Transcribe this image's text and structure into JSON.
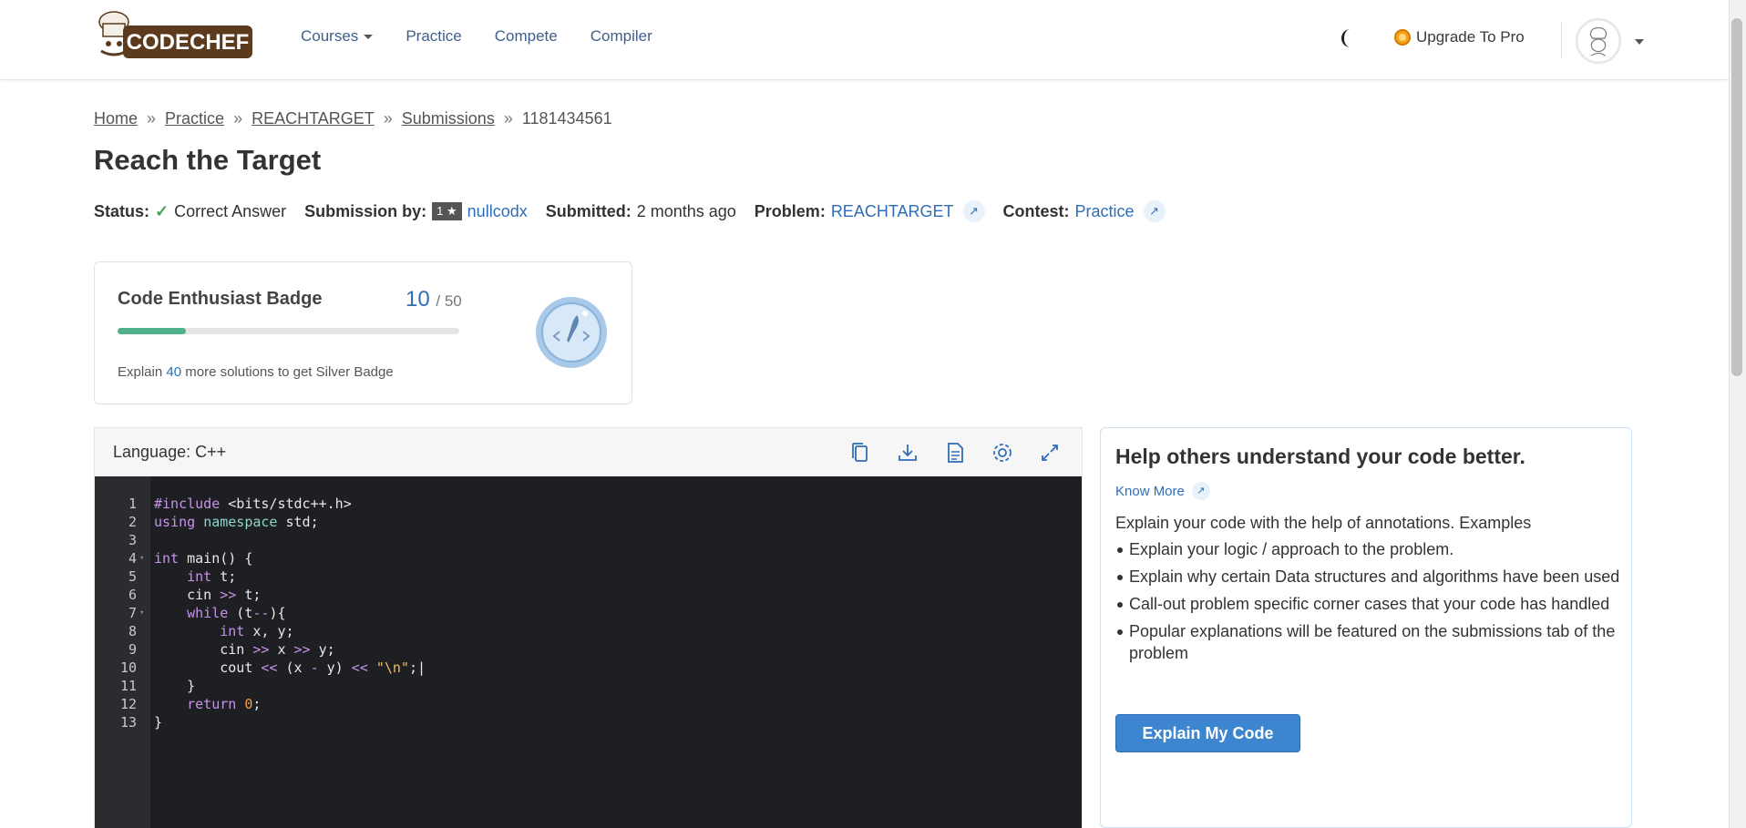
{
  "header": {
    "logo_text": "CODECHEF",
    "nav": [
      {
        "label": "Courses",
        "has_dropdown": true
      },
      {
        "label": "Practice"
      },
      {
        "label": "Compete"
      },
      {
        "label": "Compiler"
      }
    ],
    "upgrade_label": "Upgrade To Pro",
    "icons": {
      "theme": "moon-icon",
      "upgrade": "coin-icon",
      "user": "chef-avatar"
    }
  },
  "breadcrumb": {
    "items": [
      "Home",
      "Practice",
      "REACHTARGET",
      "Submissions"
    ],
    "current": "1181434561",
    "separator": "»"
  },
  "page_title": "Reach the Target",
  "meta": {
    "status_label": "Status:",
    "status_value": "Correct Answer",
    "submission_by_label": "Submission by:",
    "rank": "1 ★",
    "user": "nullcodx",
    "submitted_label": "Submitted:",
    "submitted_value": "2 months ago",
    "problem_label": "Problem:",
    "problem_value": "REACHTARGET",
    "contest_label": "Contest:",
    "contest_value": "Practice"
  },
  "badge": {
    "title": "Code Enthusiast Badge",
    "count": "10",
    "total": "/ 50",
    "progress_fraction": 0.2,
    "text_prefix": "Explain",
    "text_highlight": "40",
    "text_suffix": "more solutions to get Silver Badge"
  },
  "code": {
    "language_label": "Language: C++",
    "tools": [
      "copy-icon",
      "download-icon",
      "file-icon",
      "settings-icon",
      "fullscreen-icon"
    ],
    "line_numbers": [
      "1",
      "2",
      "3",
      "4",
      "5",
      "6",
      "7",
      "8",
      "9",
      "10",
      "11",
      "12",
      "13"
    ],
    "lines": [
      "#include <bits/stdc++.h>",
      "using namespace std;",
      "",
      "int main() {",
      "    int t;",
      "    cin >> t;",
      "    while (t--){",
      "        int x, y;",
      "        cin >> x >> y;",
      "        cout << (x - y) << \"\\n\";",
      "    }",
      "    return 0;",
      "}"
    ]
  },
  "help": {
    "title": "Help others understand your code better.",
    "know_more": "Know More",
    "intro": "Explain your code with the help of annotations. Examples",
    "items": [
      "Explain your logic / approach to the problem.",
      "Explain why certain Data structures and algorithms have been used",
      "Call-out problem specific corner cases that your code has handled",
      "Popular explanations will be featured on the submissions tab of the problem"
    ],
    "button_label": "Explain My Code"
  },
  "colors": {
    "link": "#2f6db5",
    "success": "#3aa858",
    "button": "#3d86cf",
    "editor_bg": "#1e1f22"
  }
}
